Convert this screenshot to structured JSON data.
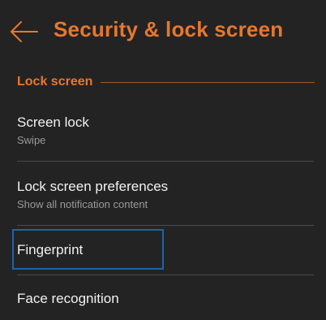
{
  "header": {
    "title": "Security & lock screen",
    "back_icon": "arrow-left-icon"
  },
  "section": {
    "title": "Lock screen"
  },
  "items": [
    {
      "title": "Screen lock",
      "subtitle": "Swipe"
    },
    {
      "title": "Lock screen preferences",
      "subtitle": "Show all notification content"
    },
    {
      "title": "Fingerprint"
    },
    {
      "title": "Face recognition"
    }
  ],
  "colors": {
    "accent": "#e8772e",
    "background": "#232323",
    "focus": "#1f63a8"
  }
}
